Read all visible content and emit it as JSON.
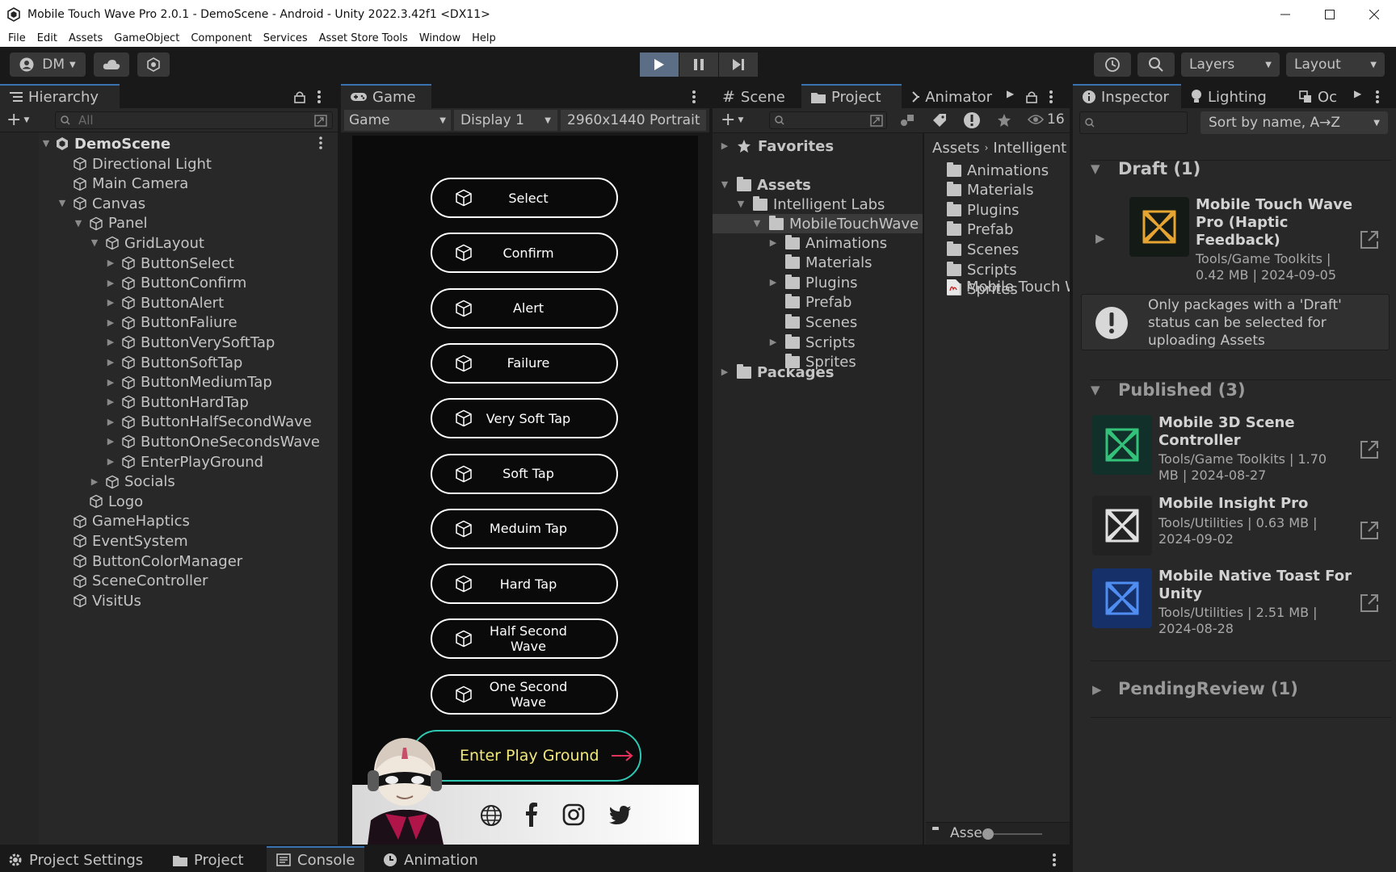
{
  "window": {
    "title": "Mobile Touch Wave Pro 2.0.1 - DemoScene - Android - Unity 2022.3.42f1 <DX11>"
  },
  "menu": [
    "File",
    "Edit",
    "Assets",
    "GameObject",
    "Component",
    "Services",
    "Asset Store Tools",
    "Window",
    "Help"
  ],
  "toolbar": {
    "account": "DM",
    "layers": "Layers",
    "layout": "Layout"
  },
  "hierarchy": {
    "tab": "Hierarchy",
    "search_placeholder": "All",
    "scene": "DemoScene",
    "items": [
      {
        "label": "Directional Light",
        "depth": 1,
        "arrow": ""
      },
      {
        "label": "Main Camera",
        "depth": 1,
        "arrow": ""
      },
      {
        "label": "Canvas",
        "depth": 1,
        "arrow": "down"
      },
      {
        "label": "Panel",
        "depth": 2,
        "arrow": "down"
      },
      {
        "label": "GridLayout",
        "depth": 3,
        "arrow": "down"
      },
      {
        "label": "ButtonSelect",
        "depth": 4,
        "arrow": "right"
      },
      {
        "label": "ButtonConfirm",
        "depth": 4,
        "arrow": "right"
      },
      {
        "label": "ButtonAlert",
        "depth": 4,
        "arrow": "right"
      },
      {
        "label": "ButtonFaliure",
        "depth": 4,
        "arrow": "right"
      },
      {
        "label": "ButtonVerySoftTap",
        "depth": 4,
        "arrow": "right"
      },
      {
        "label": "ButtonSoftTap",
        "depth": 4,
        "arrow": "right"
      },
      {
        "label": "ButtonMediumTap",
        "depth": 4,
        "arrow": "right"
      },
      {
        "label": "ButtonHardTap",
        "depth": 4,
        "arrow": "right"
      },
      {
        "label": "ButtonHalfSecondWave",
        "depth": 4,
        "arrow": "right"
      },
      {
        "label": "ButtonOneSecondsWave",
        "depth": 4,
        "arrow": "right"
      },
      {
        "label": "EnterPlayGround",
        "depth": 4,
        "arrow": "right"
      },
      {
        "label": "Socials",
        "depth": 3,
        "arrow": "right"
      },
      {
        "label": "Logo",
        "depth": 2,
        "arrow": ""
      },
      {
        "label": "GameHaptics",
        "depth": 1,
        "arrow": ""
      },
      {
        "label": "EventSystem",
        "depth": 1,
        "arrow": ""
      },
      {
        "label": "ButtonColorManager",
        "depth": 1,
        "arrow": ""
      },
      {
        "label": "SceneController",
        "depth": 1,
        "arrow": ""
      },
      {
        "label": "VisitUs",
        "depth": 1,
        "arrow": ""
      }
    ]
  },
  "game": {
    "tab": "Game",
    "mode": "Game",
    "display": "Display 1",
    "resolution": "2960x1440 Portrait",
    "buttons": [
      "Select",
      "Confirm",
      "Alert",
      "Failure",
      "Very Soft Tap",
      "Soft Tap",
      "Meduim Tap",
      "Hard Tap",
      "Half Second Wave",
      "One Second Wave"
    ],
    "enter": "Enter Play Ground"
  },
  "project": {
    "tabs": [
      "Scene",
      "Project",
      "Animator"
    ],
    "hidden_count": "16",
    "favorites": "Favorites",
    "assets": "Assets",
    "intelligent_labs": "Intelligent Labs",
    "mtw": "MobileTouchWave",
    "mtw_children": [
      "Animations",
      "Materials",
      "Plugins",
      "Prefab",
      "Scenes",
      "Scripts",
      "Sprites"
    ],
    "packages": "Packages",
    "breadcrumb": [
      "Assets",
      "Intelligent"
    ],
    "right_items": [
      "Animations",
      "Materials",
      "Plugins",
      "Prefab",
      "Scenes",
      "Scripts",
      "Sprites"
    ],
    "right_file": "Mobile Touch W",
    "bottom_path": "Asse"
  },
  "inspector": {
    "tabs": [
      "Inspector",
      "Lighting",
      "Oc"
    ],
    "sort": "Sort by name, A→Z",
    "draft_header": "Draft (1)",
    "draft_pkg": {
      "name": "Mobile Touch Wave Pro (Haptic Feedback)",
      "meta": "Tools/Game Toolkits | 0.42 MB | 2024-09-05"
    },
    "draft_note": "Only packages with a 'Draft' status can be selected for uploading Assets",
    "published_header": "Published (3)",
    "published": [
      {
        "name": "Mobile 3D Scene Controller",
        "meta": "Tools/Game Toolkits | 1.70 MB | 2024-08-27",
        "accent": "#34c27a",
        "bg": "#12302a"
      },
      {
        "name": "Mobile Insight Pro",
        "meta": "Tools/Utilities | 0.63 MB | 2024-09-02",
        "accent": "#e0e0e0",
        "bg": "#222222"
      },
      {
        "name": "Mobile Native Toast For Unity",
        "meta": "Tools/Utilities | 2.51 MB | 2024-08-28",
        "accent": "#4f8ef0",
        "bg": "#16306a"
      }
    ],
    "pending_header": "PendingReview (1)"
  },
  "bottom_tabs": [
    "Project Settings",
    "Project",
    "Console",
    "Animation"
  ]
}
